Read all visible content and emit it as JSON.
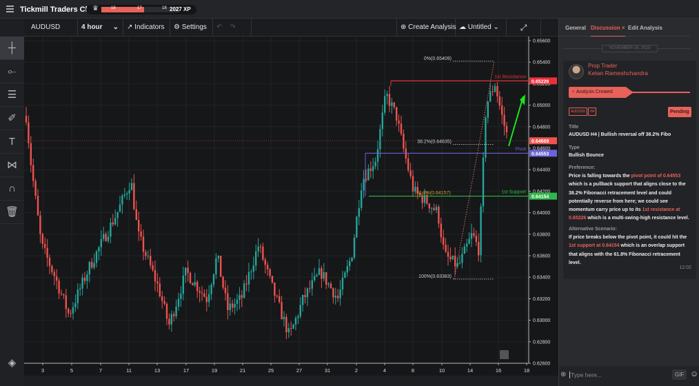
{
  "app": {
    "title": "Tickmill Traders Club",
    "xp": {
      "levels": [
        "16",
        "17",
        "18"
      ],
      "progress": 0.55,
      "points": "2027 XP"
    }
  },
  "toolbar": {
    "symbol": "AUDUSD",
    "interval": "4 hour",
    "indicators": "Indicators",
    "settings": "Settings",
    "create": "Create Analysis",
    "saved": "Untitled"
  },
  "left_tools": [
    "crosshair",
    "line",
    "fib-levels",
    "brush",
    "text",
    "pattern",
    "magnet",
    "trash"
  ],
  "panel": {
    "tabs": [
      "General",
      "Discussion",
      "Edit Analysis"
    ],
    "active_tab": "Discussion",
    "date": "NOVEMBER 16, 2023",
    "role": "Prop Trader",
    "author": "Ketan Rameshchandra",
    "event": "Analysis Created",
    "tags": [
      "AUDUSD",
      "H4"
    ],
    "status": "Pending",
    "title_label": "Title",
    "title": "AUDUSD H4 | Bullish reversal off 38.2% Fibo",
    "type_label": "Type",
    "type": "Bullish Bounce",
    "pref_label": "Preference:",
    "pref": [
      "Price is falling towards the ",
      "pivot point of 0.64553",
      " which is a pullback support that aligns close to the 38.2% Fibonacci retracement level and could potentially reverse from here; we could see momentum carry price up to its ",
      "1st resistance at 0.65226",
      " which is a multi-swing-high resistance level."
    ],
    "alt_label": "Alternative Scenario:",
    "alt": [
      "If price breaks below the pivot point, it could hit the ",
      "1st support at 0.64154",
      " which is an overlap support that aligns with the 61.8% Fibonacci retracement level."
    ],
    "time": "12:02",
    "input_placeholder": "Type here...",
    "gif": "GIF"
  },
  "chart_data": {
    "type": "candlestick",
    "symbol": "AUDUSD",
    "interval": "4 hour",
    "ylim": [
      0.626,
      0.656
    ],
    "y_ticks": [
      "0.65600",
      "0.65400",
      "0.65200",
      "0.65000",
      "0.64800",
      "0.64600",
      "0.64400",
      "0.64200",
      "0.64000",
      "0.63800",
      "0.63600",
      "0.63400",
      "0.63200",
      "0.63000",
      "0.62800",
      "0.62600"
    ],
    "x_ticks": [
      "3",
      "5",
      "7",
      "11",
      "13",
      "17",
      "19",
      "21",
      "25",
      "27",
      "31",
      "2",
      "4",
      "8",
      "10",
      "14",
      "16",
      "18"
    ],
    "current_price": "0.64669",
    "levels": [
      {
        "name": "1st Resistance",
        "value": "0.65226",
        "color": "#e8313b"
      },
      {
        "name": "Pivot",
        "value": "0.64553",
        "color": "#6b63d9"
      },
      {
        "name": "1st Support",
        "value": "0.64154",
        "color": "#2fb84a"
      }
    ],
    "fib": [
      {
        "label": "0%(0.65409)",
        "value": 0.65409
      },
      {
        "label": "38.2%(0.64635)",
        "value": 0.64635
      },
      {
        "label": "61.8%(0.64157)",
        "value": 0.64157
      },
      {
        "label": "100%(0.63383)",
        "value": 0.63383
      }
    ],
    "colors": {
      "up": "#26a69a",
      "down": "#ef5350",
      "arrow": "#19e619"
    }
  }
}
